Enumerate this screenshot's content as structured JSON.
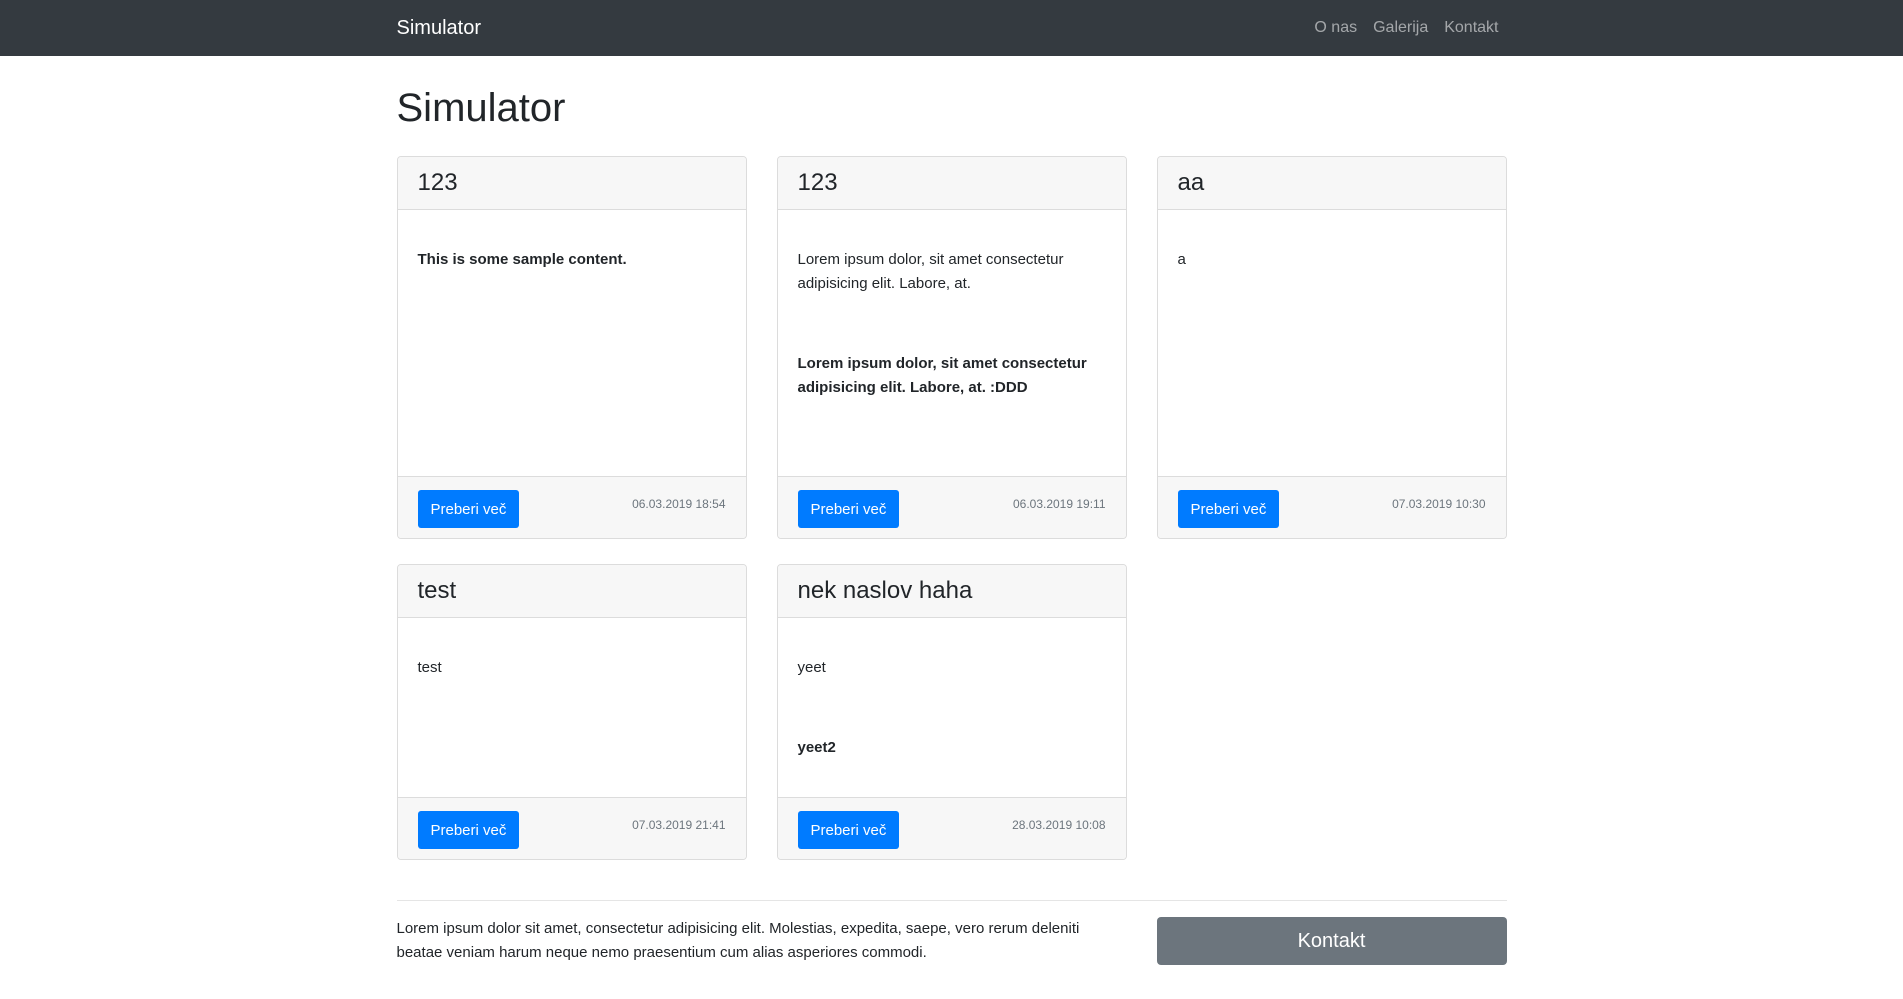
{
  "navbar": {
    "brand": "Simulator",
    "links": [
      "O nas",
      "Galerija",
      "Kontakt"
    ]
  },
  "page": {
    "title": "Simulator"
  },
  "cards": [
    {
      "title": "123",
      "paragraphs": [
        {
          "text": "This is some sample content.",
          "bold": true
        }
      ],
      "button": "Preberi več",
      "date": "06.03.2019 18:54"
    },
    {
      "title": "123",
      "paragraphs": [
        {
          "text": "Lorem ipsum dolor, sit amet consectetur adipisicing elit. Labore, at.",
          "bold": false
        },
        {
          "text": "Lorem ipsum dolor, sit amet consectetur adipisicing elit. Labore, at. :DDD",
          "bold": true
        }
      ],
      "button": "Preberi več",
      "date": "06.03.2019 19:11"
    },
    {
      "title": "aa",
      "paragraphs": [
        {
          "text": "a",
          "bold": false
        }
      ],
      "button": "Preberi več",
      "date": "07.03.2019 10:30"
    },
    {
      "title": "test",
      "paragraphs": [
        {
          "text": "test",
          "bold": false
        }
      ],
      "button": "Preberi več",
      "date": "07.03.2019 21:41"
    },
    {
      "title": "nek naslov haha",
      "paragraphs": [
        {
          "text": "yeet",
          "bold": false
        },
        {
          "text": "yeet2",
          "bold": true
        }
      ],
      "button": "Preberi več",
      "date": "28.03.2019 10:08"
    }
  ],
  "footer": {
    "text": "Lorem ipsum dolor sit amet, consectetur adipisicing elit. Molestias, expedita, saepe, vero rerum deleniti beatae veniam harum neque nemo praesentium cum alias asperiores commodi.",
    "button": "Kontakt"
  }
}
